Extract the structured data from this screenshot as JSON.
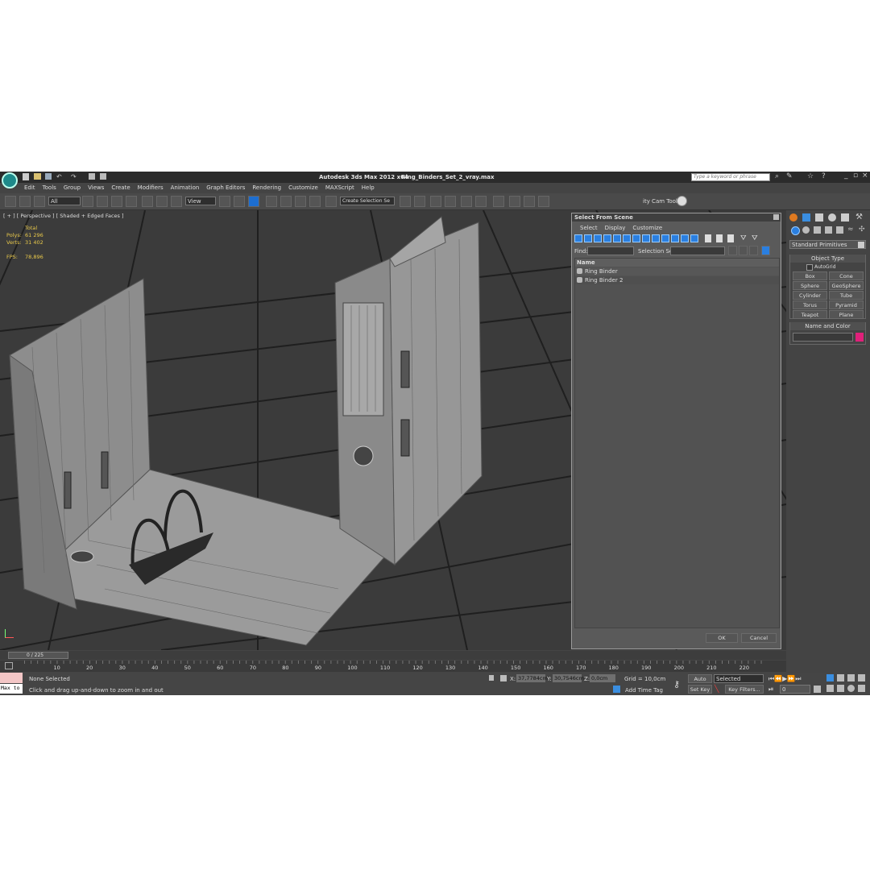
{
  "titlebar": {
    "app": "Autodesk 3ds Max  2012 x64",
    "file": "Ring_Binders_Set_2_vray.max",
    "search_placeholder": "Type a keyword or phrase"
  },
  "menu": [
    "Edit",
    "Tools",
    "Group",
    "Views",
    "Create",
    "Modifiers",
    "Animation",
    "Graph Editors",
    "Rendering",
    "Customize",
    "MAXScript",
    "Help"
  ],
  "toolbar": {
    "filter": "All",
    "refcoord": "View",
    "selection_set": "Create Selection Se",
    "axes": [
      "X",
      "Y",
      "Z",
      "XY",
      "XY"
    ],
    "cam_tool": "ity Cam Tool v"
  },
  "viewport": {
    "label": "[ + ] [ Perspective ] [ Shaded + Edged Faces ]",
    "stats": {
      "header": "Total",
      "polys_label": "Polys:",
      "polys": "61 296",
      "verts_label": "Verts:",
      "verts": "31 402",
      "fps_label": "FPS:",
      "fps": "78,896"
    }
  },
  "dialog": {
    "title": "Select From Scene",
    "menu": [
      "Select",
      "Display",
      "Customize"
    ],
    "find_label": "Find:",
    "selection_set_label": "Selection Set:",
    "column": "Name",
    "items": [
      "Ring Binder",
      "Ring Binder 2"
    ],
    "ok": "OK",
    "cancel": "Cancel"
  },
  "command_panel": {
    "dropdown": "Standard Primitives",
    "object_type": "Object Type",
    "autogrid": "AutoGrid",
    "primitives": [
      "Box",
      "Cone",
      "Sphere",
      "GeoSphere",
      "Cylinder",
      "Tube",
      "Torus",
      "Pyramid",
      "Teapot",
      "Plane"
    ],
    "name_and_color": "Name and Color",
    "object_color": "#e0207a"
  },
  "timeline": {
    "slider": "0 / 225",
    "ticks": [
      "10",
      "20",
      "30",
      "40",
      "50",
      "60",
      "70",
      "80",
      "90",
      "100",
      "110",
      "120",
      "130",
      "140",
      "150",
      "160",
      "170",
      "180",
      "190",
      "200",
      "210",
      "220"
    ]
  },
  "status": {
    "selection": "None Selected",
    "prompt": "Click and drag up-and-down to zoom in and out",
    "maxscript": "Max to",
    "x_label": "X:",
    "x": "37,7784cm",
    "y_label": "Y:",
    "y": "30,7546cm",
    "z_label": "Z:",
    "z": "0,0cm",
    "grid": "Grid = 10,0cm",
    "add_time_tag": "Add Time Tag",
    "auto_key": "Auto Key",
    "set_key": "Set Key",
    "key_mode": "Selected",
    "key_filters": "Key Filters...",
    "frame": "0"
  }
}
